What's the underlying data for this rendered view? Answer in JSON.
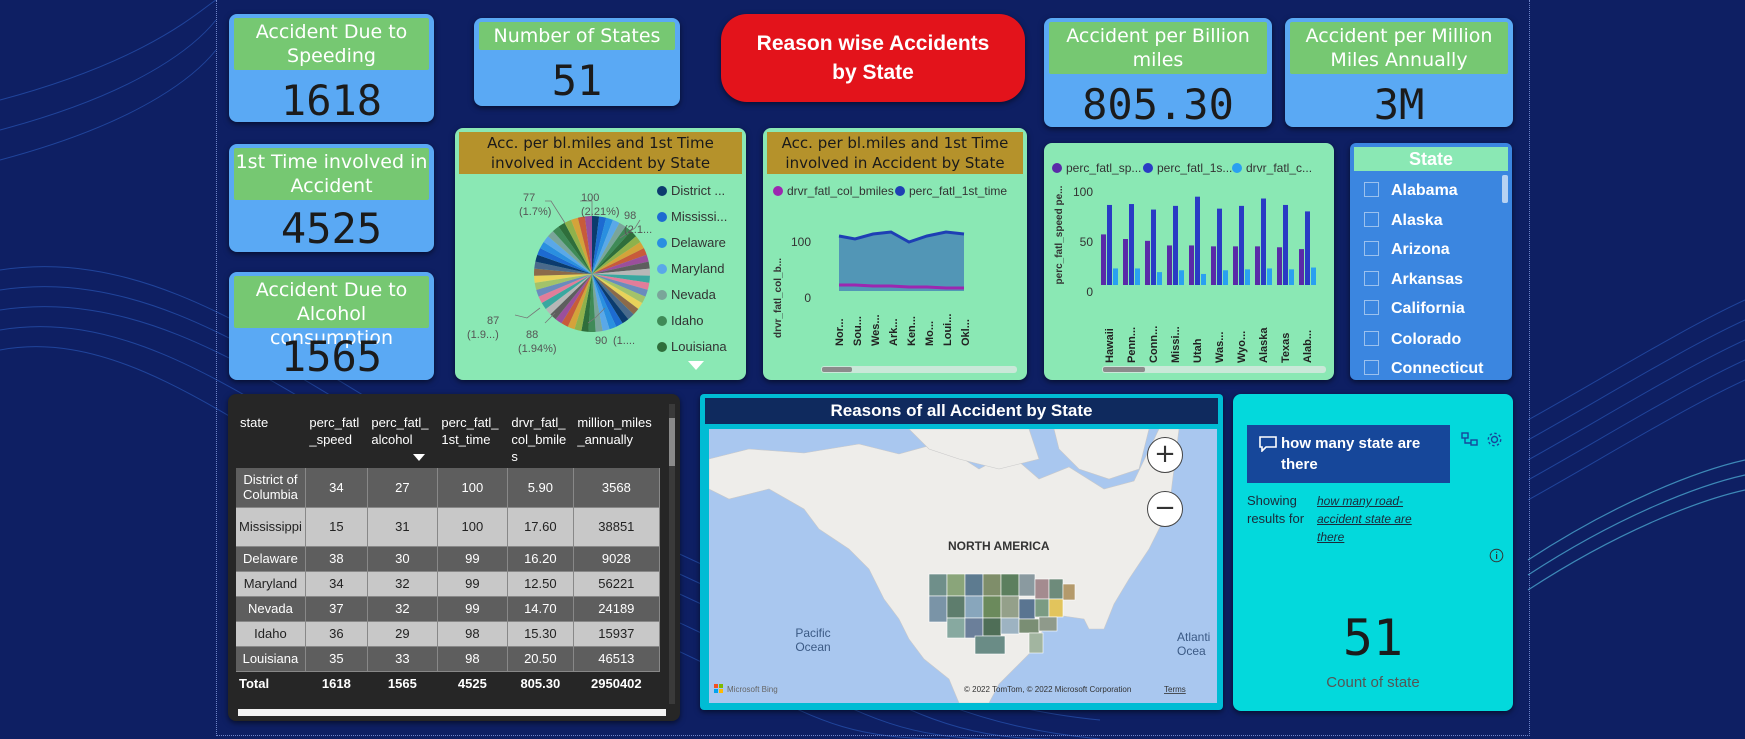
{
  "kpis": {
    "speeding": {
      "title": "Accident Due to Speeding",
      "value": "1618"
    },
    "states": {
      "title": "Number of States",
      "value": "51"
    },
    "first_time": {
      "title": "1st Time involved in Accident",
      "value": "4525"
    },
    "alcohol": {
      "title": "Accident Due to Alcohol consumption",
      "value": "1565"
    },
    "per_billion": {
      "title": "Accident per Billion miles",
      "value": "805.30"
    },
    "per_million": {
      "title": "Accident per Million Miles Annually",
      "value": "3M"
    }
  },
  "report_title": "Reason wise Accidents by State",
  "colors": {
    "background": "#0e1f63",
    "kpi_card": "#5aa9f4",
    "kpi_header": "#76c872",
    "visual_bg": "#8ae8b4",
    "visual_header": "#b5922b",
    "title_pill": "#e3131b",
    "slicer": "#3b86e0"
  },
  "pie": {
    "title": "Acc. per bl.miles and 1st Time involved in Accident by State",
    "labels": [
      {
        "value": "77",
        "pct": "(1.7%)"
      },
      {
        "value": "100",
        "pct": "(2.21%)"
      },
      {
        "value": "98",
        "pct": "(2.1..."
      },
      {
        "value": "87",
        "pct": "(1.9...)"
      },
      {
        "value": "88",
        "pct": "(1.94%)"
      },
      {
        "value": "90",
        "pct": "(1...."
      }
    ],
    "legend": [
      {
        "name": "District ...",
        "color": "#0c3b6e"
      },
      {
        "name": "Mississi...",
        "color": "#1d6bd1"
      },
      {
        "name": "Delaware",
        "color": "#2a8fe0"
      },
      {
        "name": "Maryland",
        "color": "#5aa8e8"
      },
      {
        "name": "Nevada",
        "color": "#7aa59a"
      },
      {
        "name": "Idaho",
        "color": "#3f8a57"
      },
      {
        "name": "Louisiana",
        "color": "#2f6e3b"
      }
    ]
  },
  "area_chart": {
    "title": "Acc. per bl.miles and 1st Time involved in Accident by State",
    "legend": [
      {
        "name": "drvr_fatl_col_bmiles",
        "color": "#9c27b0"
      },
      {
        "name": "perc_fatl_1st_time",
        "color": "#1e3fb4"
      }
    ],
    "ylabel": "drvr_fatl_col_b...",
    "yticks": [
      "100",
      "0"
    ]
  },
  "bar_chart": {
    "legend": [
      {
        "name": "perc_fatl_sp...",
        "color": "#5a2aa8"
      },
      {
        "name": "perc_fatl_1s...",
        "color": "#2a3bc4"
      },
      {
        "name": "drvr_fatl_c...",
        "color": "#2aa0f0"
      }
    ],
    "ylabel": "perc_fatl_speed pe...",
    "yticks": [
      "100",
      "50",
      "0"
    ]
  },
  "slicer": {
    "title": "State",
    "items": [
      "Alabama",
      "Alaska",
      "Arizona",
      "Arkansas",
      "California",
      "Colorado",
      "Connecticut"
    ]
  },
  "table": {
    "columns": [
      "state",
      "perc_fatl_speed",
      "perc_fatl_alcohol",
      "perc_fatl_1st_time",
      "drvr_fatl_col_bmiles",
      "million_miles_annually"
    ],
    "rows": [
      [
        "District of Columbia",
        "34",
        "27",
        "100",
        "5.90",
        "3568"
      ],
      [
        "Mississippi",
        "15",
        "31",
        "100",
        "17.60",
        "38851"
      ],
      [
        "Delaware",
        "38",
        "30",
        "99",
        "16.20",
        "9028"
      ],
      [
        "Maryland",
        "34",
        "32",
        "99",
        "12.50",
        "56221"
      ],
      [
        "Nevada",
        "37",
        "32",
        "99",
        "14.70",
        "24189"
      ],
      [
        "Idaho",
        "36",
        "29",
        "98",
        "15.30",
        "15937"
      ],
      [
        "Louisiana",
        "35",
        "33",
        "98",
        "20.50",
        "46513"
      ]
    ],
    "total": [
      "Total",
      "1618",
      "1565",
      "4525",
      "805.30",
      "2950402"
    ]
  },
  "map": {
    "title": "Reasons of all Accident by State",
    "continent_label": "NORTH AMERICA",
    "ocean_left": "Pacific Ocean",
    "ocean_right": "Atlanti Ocea",
    "provider": "Microsoft Bing",
    "copyright": "© 2022 TomTom, © 2022 Microsoft Corporation",
    "terms": "Terms",
    "zoom_in": "+",
    "zoom_out": "−"
  },
  "qa": {
    "question": "how many state are there",
    "showing_label": "Showing results for",
    "interpreted": "how many road-accident state are there",
    "result_value": "51",
    "result_label": "Count of state"
  }
}
